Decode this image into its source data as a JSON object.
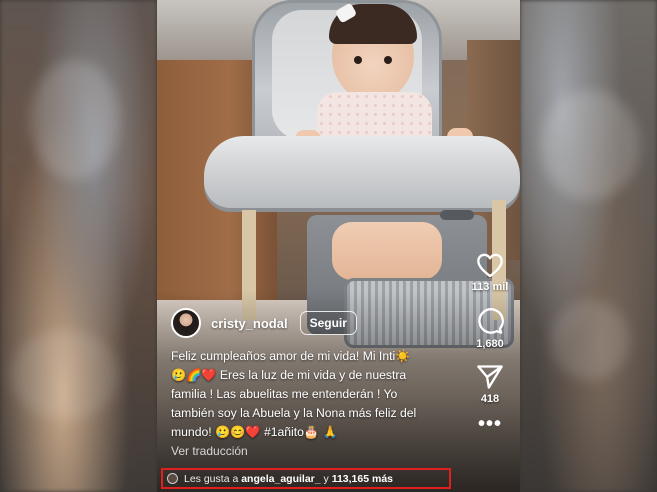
{
  "post": {
    "username": "cristy_nodal",
    "follow_label": "Seguir",
    "caption_lines": [
      "Feliz cumpleaños amor de mi vida!  Mi Inti☀️",
      "🥲🌈❤️  Eres la luz de mi vida  y de nuestra",
      "familia !  Las abuelitas me entenderán ! Yo",
      "también soy la Abuela y la Nona más feliz del",
      "mundo!  🥲😊❤️  #1añito🎂 🙏"
    ],
    "translate_label": "Ver traducción",
    "likes": {
      "prefix": "Les gusta a ",
      "user": "angela_aguilar_",
      "middle": " y ",
      "count": "113,165 más"
    }
  },
  "actions": {
    "like_count": "113 mil",
    "comment_count": "1,680",
    "share_count": "418",
    "more_label": "•••"
  },
  "colors": {
    "highlight_box": "#e0201e",
    "text": "#ffffff"
  }
}
